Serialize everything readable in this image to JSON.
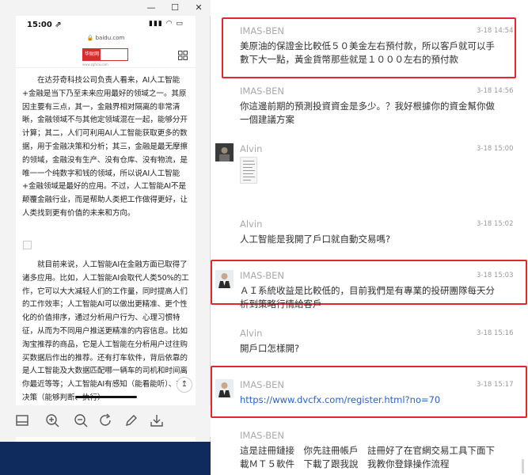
{
  "viewer": {
    "window_buttons": {
      "minimize": "—",
      "maximize": "☐",
      "close": "✕"
    },
    "phone": {
      "status_time": "15:00 ⇗",
      "status_icons": "▮▮▮ ◠ ▭",
      "url": "🔒 baidu.com",
      "brand_logo_left": "华财网",
      "brand_logo_right": "",
      "brand_sub": "www.zghcw.com",
      "paragraph_1": "在达芬奇科技公司负责人看来，AI人工智能+金融是当下乃至未来应用最好的领域之一。其原因主要有三点，其一，金融界相对隔离的非常清晰，金融领域不与其他定领域混在一起，能够分开计算；其二，人们可利用AI人工智能获取更多的数据，用于金融决策和分析；其三，金融是最无摩擦的领域，金融没有生产、没有仓库、没有物流，是唯一一个纯数字和钱的领域，所以说AI人工智能+金融领域是最好的应用。不过，人工智能AI不是颠覆金融行业，而是帮助人类把工作做得更好，让人类找到更有价值的未来和方向。",
      "paragraph_2": "就目前来说，人工智能AI在金融方面已取得了诸多应用。比如，人工智能AI会取代人类50%的工作，它可以大大减轻人们的工作量，同时提高人们的工作效率；人工智能AI可以做出更精准、更个性化的价值排序，通过分析用户行为、心理习惯特征，从而为不同用户推送更精准的内容信息。比如淘宝推荐的商品，它是人工智能在分析用户过往购买数据后作出的推荐。还有打车软件，背后依靠的是人工智能及大数据匹配哪一辆车的司机和时间离你最近等等；人工智能AI有感知（能看能听）、有决策（能够判断、执行）"
    },
    "toolbar": [
      "save-icon",
      "zoom-in-icon",
      "zoom-out-icon",
      "rotate-icon",
      "edit-icon",
      "download-icon"
    ],
    "scroll_top_glyph": "↥"
  },
  "chat": {
    "messages": [
      {
        "name": "IMAS-BEN",
        "time": "3-18 14:54",
        "text": "美原油的保證金比較低５０美金左右預付款，所以客戶就可以手數下大一點，黃金貨幣那些就是１０００左右的預付款"
      },
      {
        "name": "IMAS-BEN",
        "time": "3-18 14:56",
        "text": "你這邊前期的預測投資資金是多少。？我好根據你的資金幫你做一個建議方案"
      },
      {
        "name": "Alvin",
        "time": "3-18 15:00",
        "text": ""
      },
      {
        "name": "Alvin",
        "time": "3-18 15:02",
        "text": "人工智能是我開了戶口就自動交易嗎?"
      },
      {
        "name": "IMAS-BEN",
        "time": "3-18 15:03",
        "text": "ＡＩ系統收益是比較低的，目前我們是有專業的投研團隊每天分析到策略行情給客戶"
      },
      {
        "name": "Alvin",
        "time": "3-18 15:16",
        "text": "開戶口怎樣開?"
      },
      {
        "name": "IMAS-BEN",
        "time": "3-18 15:17",
        "text": "https://www.dvcfx.com/register.html?no=70"
      },
      {
        "name": "IMAS-BEN",
        "time": "",
        "text": "這是註冊鏈接　你先註冊帳戶　註冊好了在官網交易工具下面下載ＭＴ５軟件　下載了跟我說　我教你登錄操作流程"
      }
    ]
  },
  "colors": {
    "highlight": "#e5262d",
    "link": "#2962c7",
    "brand_red": "#d32f2f"
  }
}
